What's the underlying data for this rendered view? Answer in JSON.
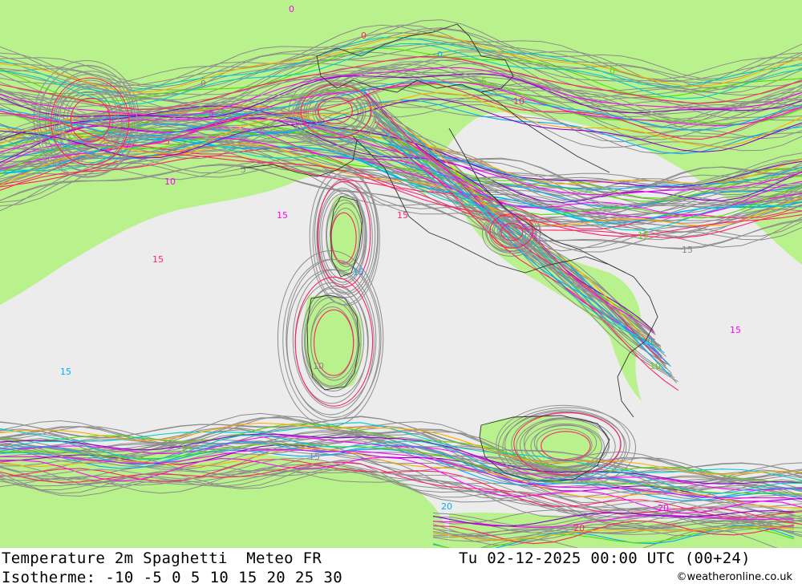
{
  "map": {
    "colors": {
      "warm_bg": "#ececec",
      "cold_fill": "#b9f28c",
      "border": "#333333",
      "spaghetti": "#8c8c8c",
      "iso_colors": [
        "#ff00ff",
        "#00aaff",
        "#55dd00",
        "#ff2266",
        "#8800cc",
        "#ffaa00",
        "#00cccc",
        "#999999"
      ]
    },
    "contour_labels": [
      {
        "text": "0"
      },
      {
        "text": "0"
      },
      {
        "text": "0"
      },
      {
        "text": "0"
      },
      {
        "text": "0"
      },
      {
        "text": "5"
      },
      {
        "text": "5"
      },
      {
        "text": "5"
      },
      {
        "text": "5"
      },
      {
        "text": "5"
      },
      {
        "text": "10"
      },
      {
        "text": "10"
      },
      {
        "text": "10"
      },
      {
        "text": "10"
      },
      {
        "text": "10"
      },
      {
        "text": "15"
      },
      {
        "text": "15"
      },
      {
        "text": "15"
      },
      {
        "text": "15"
      },
      {
        "text": "15"
      },
      {
        "text": "15"
      },
      {
        "text": "15"
      },
      {
        "text": "15"
      },
      {
        "text": "15"
      },
      {
        "text": "15"
      },
      {
        "text": "20"
      },
      {
        "text": "20"
      },
      {
        "text": "20"
      }
    ]
  },
  "footer": {
    "title": "Temperature 2m Spaghetti  Meteo FR",
    "run": "Tu 02-12-2025 00:00 UTC (00+24)",
    "iso_label": "Isotherme:",
    "iso_values": [
      "-10",
      "-5",
      "0",
      "5",
      "10",
      "15",
      "20",
      "25",
      "30"
    ],
    "credit": "©weatheronline.co.uk"
  }
}
